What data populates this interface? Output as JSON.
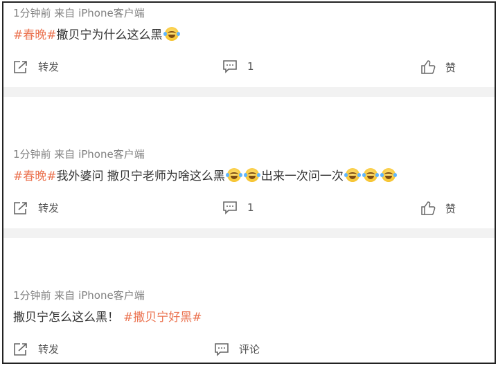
{
  "posts": [
    {
      "meta": "1分钟前  来自 iPhone客户端",
      "tag": "#春晚#",
      "text1": " 撒贝宁为什么这么黑",
      "text2": "",
      "repost": "转发",
      "comment": "1",
      "like": "赞"
    },
    {
      "meta": "1分钟前  来自 iPhone客户端",
      "tag": "#春晚#",
      "text1": "我外婆问 撒贝宁老师为啥这么黑",
      "text2": "出来一次问一次",
      "repost": "转发",
      "comment": "1",
      "like": "赞"
    },
    {
      "meta": "1分钟前  来自 iPhone客户端",
      "text1": "撒贝宁怎么这么黑！",
      "tag": "#撒贝宁好黑#",
      "repost": "转发",
      "comment": "评论"
    }
  ],
  "icons": [
    "repost-icon",
    "comment-icon",
    "like-icon",
    "laugh-cry-emoji"
  ],
  "colors": {
    "tag": "#eb7350",
    "meta": "#808080",
    "separator": "#f2f2f2",
    "border": "#222222"
  }
}
